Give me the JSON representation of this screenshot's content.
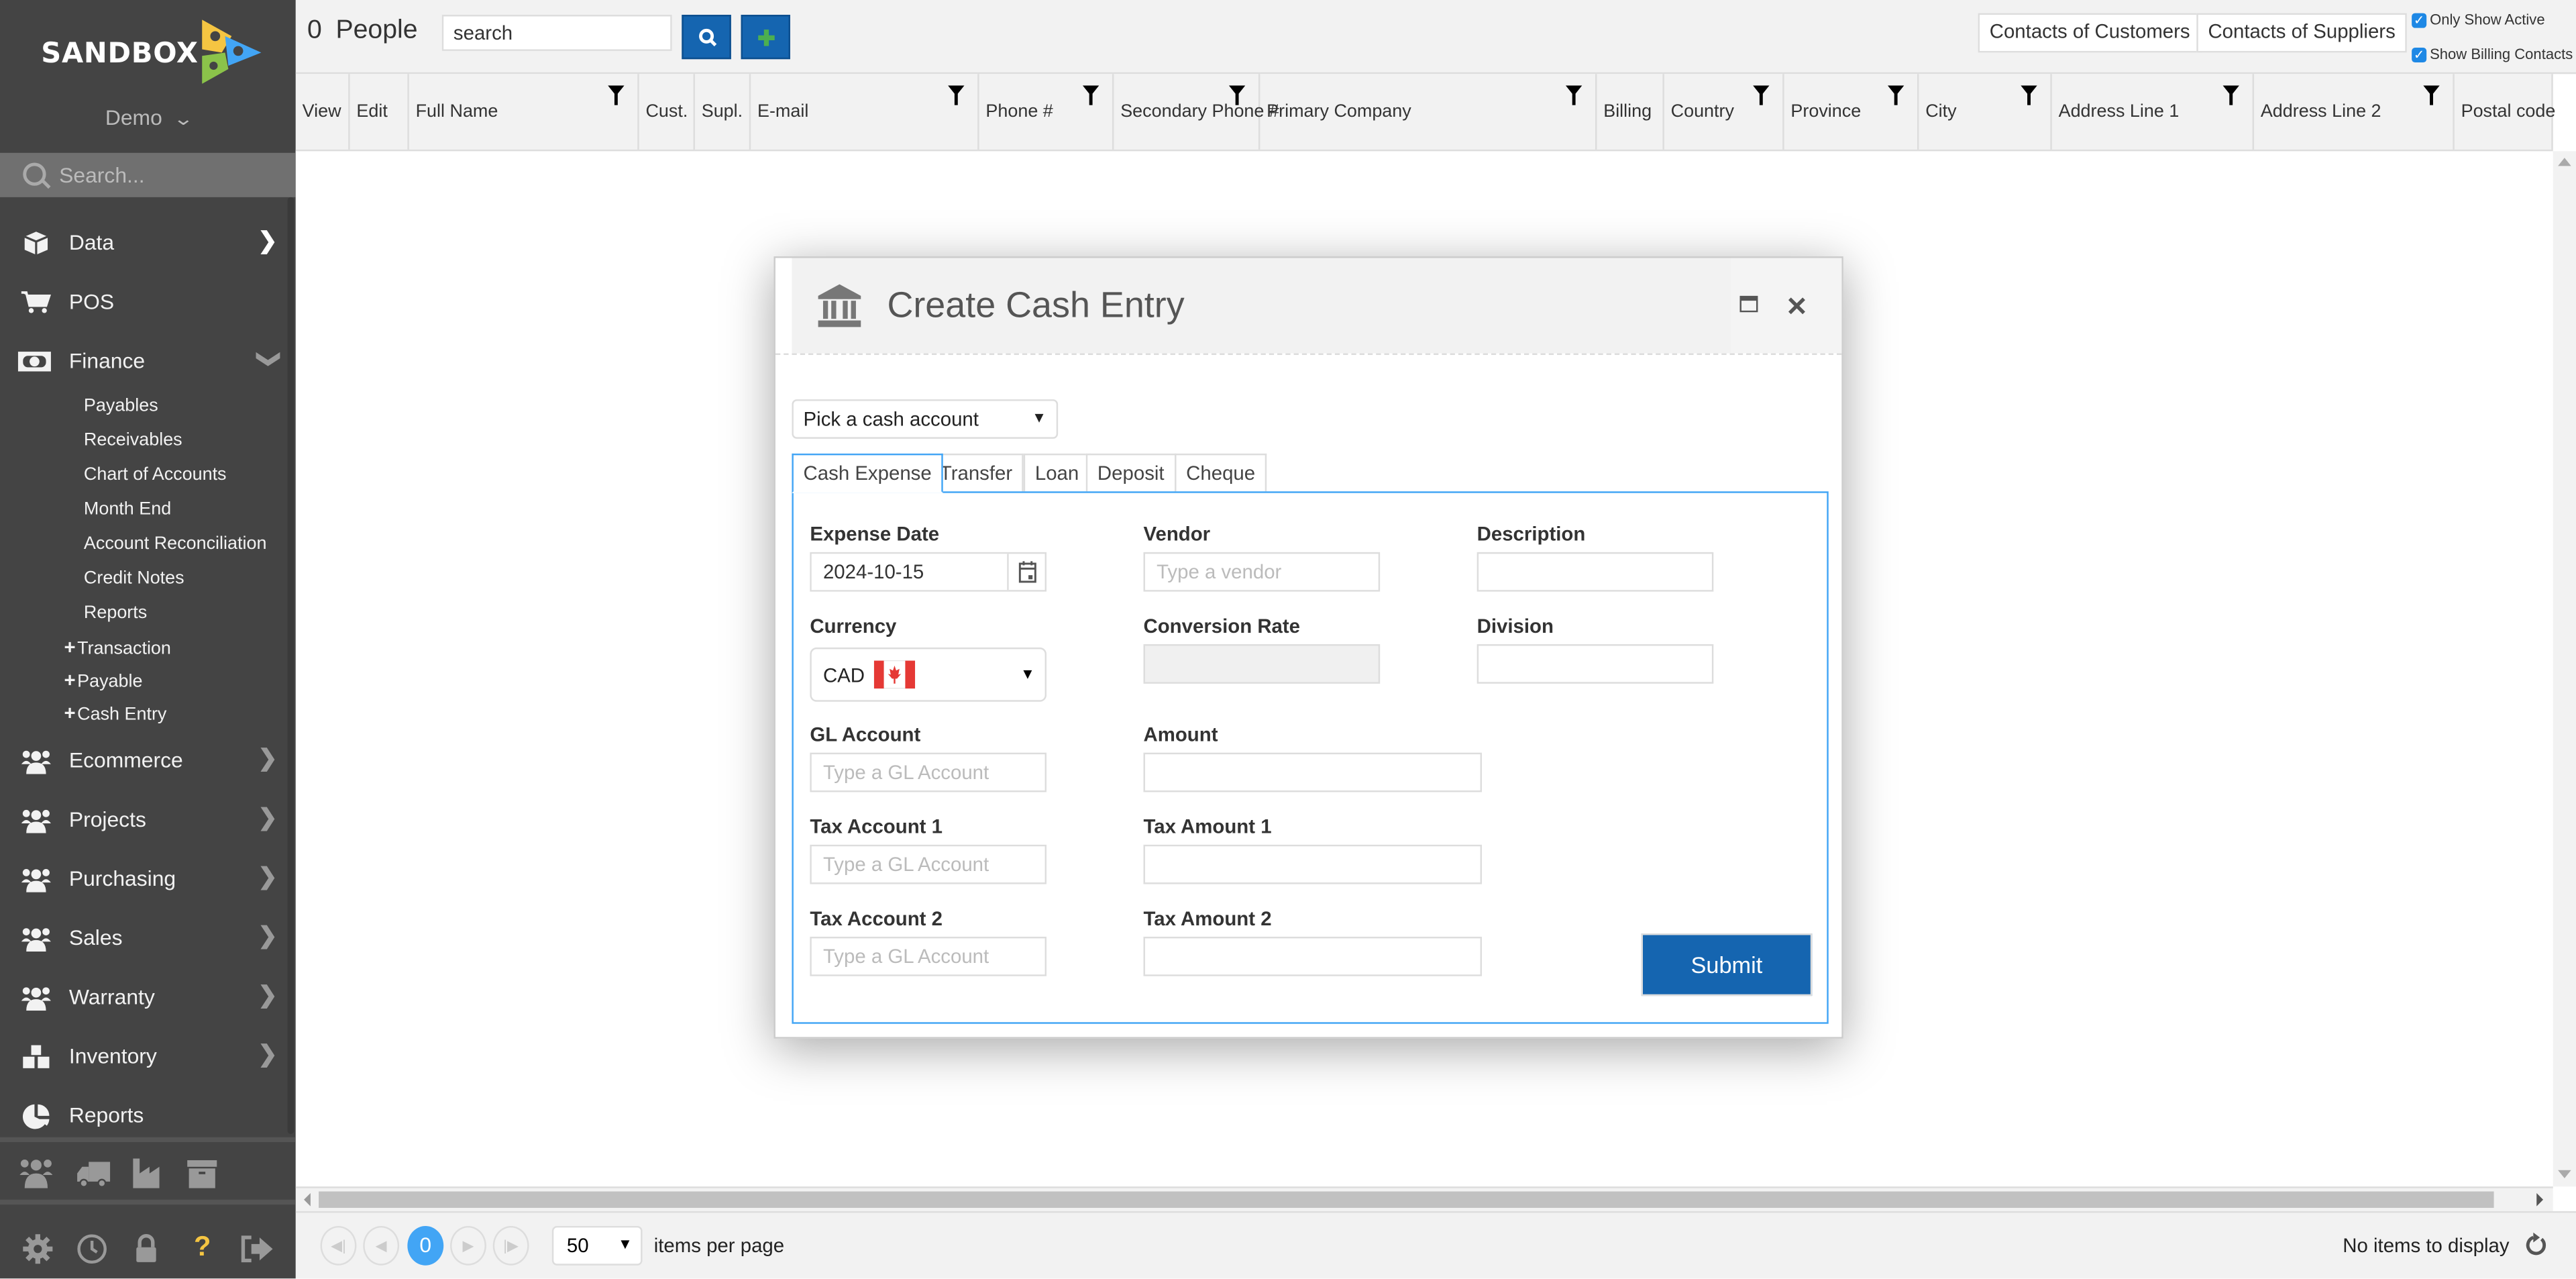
{
  "sidebar": {
    "brand": "SANDBOX",
    "company": "Demo",
    "search_placeholder": "Search...",
    "items": [
      {
        "label": "Data",
        "icon": "cube-icon",
        "arrow": "chevron-right-icon"
      },
      {
        "label": "POS",
        "icon": "cart-icon"
      },
      {
        "label": "Finance",
        "icon": "money-bill-icon",
        "arrow": "chevron-down-icon"
      },
      {
        "label": "Ecommerce",
        "icon": "users-icon",
        "arrow": "chevron-right-icon"
      },
      {
        "label": "Projects",
        "icon": "users-icon",
        "arrow": "chevron-right-icon"
      },
      {
        "label": "Purchasing",
        "icon": "users-icon",
        "arrow": "chevron-right-icon"
      },
      {
        "label": "Sales",
        "icon": "users-icon",
        "arrow": "chevron-right-icon"
      },
      {
        "label": "Warranty",
        "icon": "users-icon",
        "arrow": "chevron-right-icon"
      },
      {
        "label": "Inventory",
        "icon": "cubes-icon",
        "arrow": "chevron-right-icon"
      },
      {
        "label": "Reports",
        "icon": "pie-chart-icon"
      }
    ],
    "finance_sub": [
      "Payables",
      "Receivables",
      "Chart of Accounts",
      "Month End",
      "Account Reconciliation",
      "Credit Notes",
      "Reports"
    ],
    "finance_add": [
      "Transaction",
      "Payable",
      "Cash Entry"
    ],
    "quick_icons": [
      "users-icon",
      "truck-icon",
      "industry-icon",
      "archive-icon"
    ],
    "footer_icons": [
      "gear-icon",
      "clock-icon",
      "lock-icon",
      "question-icon",
      "sign-out-icon"
    ]
  },
  "toolbar": {
    "count": "0",
    "entity": "People",
    "search_value": "search",
    "contacts_customers": "Contacts of Customers",
    "contacts_suppliers": "Contacts of Suppliers",
    "only_show_active": "Only Show Active",
    "only_show_active_checked": true,
    "show_billing_contacts": "Show Billing Contacts",
    "show_billing_contacts_checked": true
  },
  "grid": {
    "columns": [
      "View",
      "Edit",
      "Full Name",
      "Cust.",
      "Supl.",
      "E-mail",
      "Phone #",
      "Secondary Phone #",
      "Primary Company",
      "Billing",
      "Country",
      "Province",
      "City",
      "Address Line 1",
      "Address Line 2",
      "Postal code"
    ]
  },
  "pager": {
    "current_page": "0",
    "per_page": "50",
    "per_page_label": "items per page",
    "status": "No items to display"
  },
  "modal": {
    "title": "Create Cash Entry",
    "cash_account_placeholder": "Pick a cash account",
    "tabs": [
      "Cash Expense",
      "Transfer",
      "Loan",
      "Deposit",
      "Cheque"
    ],
    "active_tab": "Cash Expense",
    "fields": {
      "expense_date_label": "Expense Date",
      "expense_date_value": "2024-10-15",
      "vendor_label": "Vendor",
      "vendor_placeholder": "Type a vendor",
      "description_label": "Description",
      "currency_label": "Currency",
      "currency_value": "CAD",
      "conversion_rate_label": "Conversion Rate",
      "division_label": "Division",
      "gl_account_label": "GL Account",
      "gl_account_placeholder": "Type a GL Account",
      "amount_label": "Amount",
      "tax_account_1_label": "Tax Account 1",
      "tax_account_1_placeholder": "Type a GL Account",
      "tax_amount_1_label": "Tax Amount 1",
      "tax_account_2_label": "Tax Account 2",
      "tax_account_2_placeholder": "Type a GL Account",
      "tax_amount_2_label": "Tax Amount 2"
    },
    "submit_label": "Submit"
  },
  "colors": {
    "sidebar_bg": "#444444",
    "primary_button": "#1565b0",
    "accent_blue": "#42a5f5",
    "add_icon_green": "#4caf50",
    "help_icon_yellow": "#f5c542"
  }
}
